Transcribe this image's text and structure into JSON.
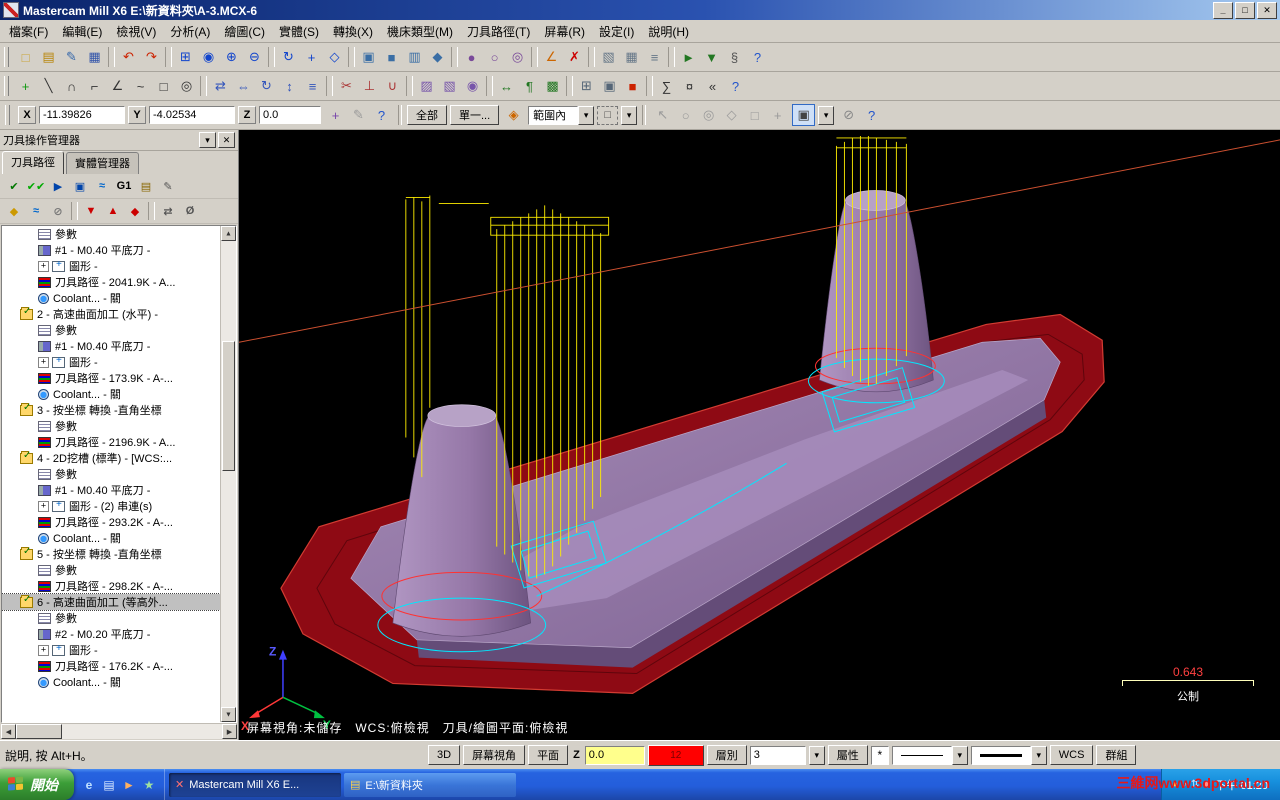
{
  "colors": {
    "toolpath_yellow": "#ffee00",
    "contour_cyan": "#00e8ff",
    "boundary_red": "#ff3232",
    "stock_red": "#8e0a14",
    "part_purple": "#967aa9",
    "viewport_bg": "#000000",
    "taskbar_blue": "#245edb",
    "title_blue": "#0a246a"
  },
  "window": {
    "title": "Mastercam Mill X6  E:\\新資料夾\\A-3.MCX-6",
    "controls": [
      {
        "name": "minimize-button",
        "glyph": "_"
      },
      {
        "name": "maximize-button",
        "glyph": "□"
      },
      {
        "name": "close-button",
        "glyph": "✕"
      }
    ]
  },
  "menu": {
    "items": [
      "檔案(F)",
      "編輯(E)",
      "檢視(V)",
      "分析(A)",
      "繪圖(C)",
      "實體(S)",
      "轉換(X)",
      "機床類型(M)",
      "刀具路徑(T)",
      "屏幕(R)",
      "設定(I)",
      "說明(H)"
    ]
  },
  "toolbar1": {
    "items": [
      {
        "name": "new-file-icon",
        "glyph": "□",
        "color": "#caa53a"
      },
      {
        "name": "open-file-icon",
        "glyph": "▤",
        "color": "#b8860b"
      },
      {
        "name": "edit-icon",
        "glyph": "✎",
        "color": "#3366aa"
      },
      {
        "name": "save-icon",
        "glyph": "▦",
        "color": "#3355aa"
      },
      {
        "name": "separator",
        "cls": "sep"
      },
      {
        "name": "undo-icon",
        "glyph": "↶",
        "color": "#cc2200"
      },
      {
        "name": "redo-icon",
        "glyph": "↷",
        "color": "#cc2200"
      },
      {
        "name": "separator",
        "cls": "sep"
      },
      {
        "name": "zoom-window-icon",
        "glyph": "⊞",
        "color": "#1144cc"
      },
      {
        "name": "zoom-target-icon",
        "glyph": "◉",
        "color": "#1144cc"
      },
      {
        "name": "zoom-in-icon",
        "glyph": "⊕",
        "color": "#1144cc"
      },
      {
        "name": "zoom-out-icon",
        "glyph": "⊖",
        "color": "#1144cc"
      },
      {
        "name": "separator",
        "cls": "sep"
      },
      {
        "name": "dynamic-rotate-icon",
        "glyph": "↻",
        "color": "#1144cc"
      },
      {
        "name": "pan-icon",
        "glyph": "+",
        "color": "#1144cc"
      },
      {
        "name": "fit-screen-icon",
        "glyph": "◇",
        "color": "#1144cc"
      },
      {
        "name": "separator",
        "cls": "sep"
      },
      {
        "name": "gview-top-icon",
        "glyph": "▣",
        "color": "#3a6ea5"
      },
      {
        "name": "gview-front-icon",
        "glyph": "■",
        "color": "#3a6ea5"
      },
      {
        "name": "gview-side-icon",
        "glyph": "▥",
        "color": "#3a6ea5"
      },
      {
        "name": "gview-iso-icon",
        "glyph": "◆",
        "color": "#3a6ea5"
      },
      {
        "name": "separator",
        "cls": "sep"
      },
      {
        "name": "shading-icon",
        "glyph": "●",
        "color": "#7a4a9a"
      },
      {
        "name": "wireframe-icon",
        "glyph": "○",
        "color": "#7a4a9a"
      },
      {
        "name": "translucency-icon",
        "glyph": "◎",
        "color": "#7a4a9a"
      },
      {
        "name": "separator",
        "cls": "sep"
      },
      {
        "name": "analyze-icon",
        "glyph": "∠",
        "color": "#cc6600"
      },
      {
        "name": "delete-entity-icon",
        "glyph": "✗",
        "color": "#cc0000"
      },
      {
        "name": "separator",
        "cls": "sep"
      },
      {
        "name": "planes-icon",
        "glyph": "▧",
        "color": "#667788"
      },
      {
        "name": "grid-icon",
        "glyph": "▦",
        "color": "#667788"
      },
      {
        "name": "levels-icon",
        "glyph": "≡",
        "color": "#667788"
      },
      {
        "name": "separator",
        "cls": "sep"
      },
      {
        "name": "toolpath-group-icon",
        "glyph": "►",
        "color": "#227722"
      },
      {
        "name": "machine-group-icon",
        "glyph": "▼",
        "color": "#227722"
      },
      {
        "name": "run-addin-icon",
        "glyph": "§",
        "color": "#555555"
      },
      {
        "name": "help-icon",
        "glyph": "?",
        "color": "#2255cc"
      }
    ]
  },
  "toolbar2": {
    "items": [
      {
        "name": "create-point-icon",
        "glyph": "+",
        "color": "#119911"
      },
      {
        "name": "create-line-icon",
        "glyph": "╲",
        "color": "#333333"
      },
      {
        "name": "create-arc-icon",
        "glyph": "∩",
        "color": "#333333"
      },
      {
        "name": "create-fillet-icon",
        "glyph": "⌐",
        "color": "#333333"
      },
      {
        "name": "create-chamfer-icon",
        "glyph": "∠",
        "color": "#333333"
      },
      {
        "name": "create-spline-icon",
        "glyph": "~",
        "color": "#333333"
      },
      {
        "name": "create-rect-icon",
        "glyph": "□",
        "color": "#333333"
      },
      {
        "name": "create-ellipse-icon",
        "glyph": "◎",
        "color": "#333333"
      },
      {
        "name": "separator",
        "cls": "sep"
      },
      {
        "name": "xform-translate-icon",
        "glyph": "⇄",
        "color": "#3355bb"
      },
      {
        "name": "xform-mirror-icon",
        "glyph": "⇔",
        "color": "#3355bb"
      },
      {
        "name": "xform-rotate-icon",
        "glyph": "↻",
        "color": "#3355bb"
      },
      {
        "name": "xform-scale-icon",
        "glyph": "↕",
        "color": "#3355bb"
      },
      {
        "name": "xform-offset-icon",
        "glyph": "≡",
        "color": "#3355bb"
      },
      {
        "name": "separator",
        "cls": "sep"
      },
      {
        "name": "trim-icon",
        "glyph": "✂",
        "color": "#aa3333"
      },
      {
        "name": "break-icon",
        "glyph": "⊥",
        "color": "#aa3333"
      },
      {
        "name": "join-icon",
        "glyph": "∪",
        "color": "#aa3333"
      },
      {
        "name": "separator",
        "cls": "sep"
      },
      {
        "name": "surface-create-icon",
        "glyph": "▨",
        "color": "#7755aa"
      },
      {
        "name": "solid-extrude-icon",
        "glyph": "▧",
        "color": "#7755aa"
      },
      {
        "name": "solid-revolve-icon",
        "glyph": "◉",
        "color": "#7755aa"
      },
      {
        "name": "separator",
        "cls": "sep"
      },
      {
        "name": "dimension-icon",
        "glyph": "↔",
        "color": "#227722"
      },
      {
        "name": "note-icon",
        "glyph": "¶",
        "color": "#227722"
      },
      {
        "name": "hatch-icon",
        "glyph": "▩",
        "color": "#227722"
      },
      {
        "name": "separator",
        "cls": "sep"
      },
      {
        "name": "layer-manager-icon",
        "glyph": "⊞",
        "color": "#556677"
      },
      {
        "name": "attributes-icon",
        "glyph": "▣",
        "color": "#556677"
      },
      {
        "name": "color-swatch-icon",
        "glyph": "■",
        "color": "#cc2200"
      },
      {
        "name": "separator",
        "cls": "sep"
      },
      {
        "name": "calculator-icon",
        "glyph": "∑",
        "color": "#333333"
      },
      {
        "name": "configuration-icon",
        "glyph": "¤",
        "color": "#333333"
      },
      {
        "name": "mru-icon",
        "glyph": "«",
        "color": "#333333"
      },
      {
        "name": "help-2-icon",
        "glyph": "?",
        "color": "#2255cc"
      }
    ]
  },
  "ribbon": {
    "x_label": "X",
    "x_value": "-11.39826",
    "y_label": "Y",
    "y_value": "-4.02534",
    "z_label": "Z",
    "z_value": "0.0",
    "icons_a": [
      {
        "name": "autocursor-icon",
        "glyph": "+",
        "color": "#7744aa"
      },
      {
        "name": "fastpoint-icon",
        "glyph": "✎",
        "color": "#999999"
      },
      {
        "name": "cursor-help-icon",
        "glyph": "?",
        "color": "#2255cc"
      }
    ],
    "all_label": "全部",
    "single_label": "單一...",
    "icons_mid": [
      {
        "name": "selection-mask-icon",
        "glyph": "◈",
        "color": "#cc6600"
      }
    ],
    "range_value": "範圍內",
    "inshape_glyph": "□",
    "icons_b": [
      {
        "name": "select-arrow-icon",
        "glyph": "↖",
        "color": "#9a9a9a"
      },
      {
        "name": "select-circle-icon",
        "glyph": "○",
        "color": "#9a9a9a"
      },
      {
        "name": "select-double-circle-icon",
        "glyph": "◎",
        "color": "#9a9a9a"
      },
      {
        "name": "select-diamond-icon",
        "glyph": "◇",
        "color": "#9a9a9a"
      },
      {
        "name": "select-box-icon",
        "glyph": "□",
        "color": "#9a9a9a"
      },
      {
        "name": "select-plus-icon",
        "glyph": "+",
        "color": "#9a9a9a"
      }
    ],
    "window_select_glyph": "▣",
    "icons_c": [
      {
        "name": "unselect-all-icon",
        "glyph": "⊘",
        "color": "#888888"
      },
      {
        "name": "selection-help-icon",
        "glyph": "?",
        "color": "#2255cc"
      }
    ]
  },
  "panel": {
    "title": "刀具操作管理器",
    "header_buttons": [
      {
        "name": "panel-menu-button",
        "glyph": "▾"
      },
      {
        "name": "panel-close-button",
        "glyph": "✕"
      }
    ],
    "tabs": [
      {
        "label": "刀具路徑",
        "cls": "active"
      },
      {
        "label": "實體管理器",
        "cls": ""
      }
    ],
    "toolbar1": [
      {
        "name": "select-all-operations-icon",
        "glyph": "✔",
        "color": "#007700"
      },
      {
        "name": "regen-all-operations-icon",
        "glyph": "✔✔",
        "color": "#00aa00"
      },
      {
        "name": "backplot-icon",
        "glyph": "▶",
        "color": "#0044aa"
      },
      {
        "name": "verify-icon",
        "glyph": "▣",
        "color": "#0044aa"
      },
      {
        "name": "simulate-icon",
        "glyph": "≈",
        "color": "#0066cc"
      },
      {
        "name": "post-icon",
        "glyph": "G1",
        "color": "#000000"
      },
      {
        "name": "feed-optimize-icon",
        "glyph": "▤",
        "color": "#886600"
      },
      {
        "name": "edit-operations-icon",
        "glyph": "✎",
        "color": "#555555"
      }
    ],
    "toolbar2": [
      {
        "name": "lock-icon",
        "glyph": "◆",
        "color": "#cc9900"
      },
      {
        "name": "toggle-toolpath-display-icon",
        "glyph": "≈",
        "color": "#0066cc"
      },
      {
        "name": "toggle-gouge-icon",
        "glyph": "⊘",
        "color": "#777777"
      },
      {
        "name": "separator",
        "cls": "sep"
      },
      {
        "name": "insert-indicator-down-icon",
        "glyph": "▼",
        "color": "#cc0000"
      },
      {
        "name": "insert-indicator-up-icon",
        "glyph": "▲",
        "color": "#cc0000"
      },
      {
        "name": "insert-arrow-icon",
        "glyph": "◆",
        "color": "#cc0000"
      },
      {
        "name": "separator",
        "cls": "sep"
      },
      {
        "name": "swap-display-icon",
        "glyph": "⇄",
        "color": "#555555"
      },
      {
        "name": "single-display-icon",
        "glyph": "Ø",
        "color": "#555555"
      }
    ],
    "tree": [
      {
        "label": "參數",
        "pad": "36px",
        "iconcls": "ic-params",
        "cls": ""
      },
      {
        "label": "#1 - M0.40 平底刀 -",
        "pad": "36px",
        "iconcls": "ic-tool",
        "cls": ""
      },
      {
        "label": "圖形 -",
        "pad": "36px",
        "iconcls": "ic-geom",
        "cls": "hasplus"
      },
      {
        "label": "刀具路徑 - 2041.9K - A...",
        "pad": "36px",
        "iconcls": "ic-path",
        "cls": ""
      },
      {
        "label": "Coolant... - 關",
        "pad": "36px",
        "iconcls": "ic-coolant",
        "cls": ""
      },
      {
        "label": "2 - 高速曲面加工 (水平) -",
        "pad": "18px",
        "iconcls": "ic-folder",
        "cls": ""
      },
      {
        "label": "參數",
        "pad": "36px",
        "iconcls": "ic-params",
        "cls": ""
      },
      {
        "label": "#1 - M0.40 平底刀 -",
        "pad": "36px",
        "iconcls": "ic-tool",
        "cls": ""
      },
      {
        "label": "圖形 -",
        "pad": "36px",
        "iconcls": "ic-geom",
        "cls": "hasplus"
      },
      {
        "label": "刀具路徑 - 173.9K - A-...",
        "pad": "36px",
        "iconcls": "ic-path",
        "cls": ""
      },
      {
        "label": "Coolant... - 關",
        "pad": "36px",
        "iconcls": "ic-coolant",
        "cls": ""
      },
      {
        "label": "3 - 按坐標 轉換 -直角坐標",
        "pad": "18px",
        "iconcls": "ic-folder",
        "cls": ""
      },
      {
        "label": "參數",
        "pad": "36px",
        "iconcls": "ic-params",
        "cls": ""
      },
      {
        "label": "刀具路徑 - 2196.9K - A...",
        "pad": "36px",
        "iconcls": "ic-path",
        "cls": ""
      },
      {
        "label": "4 - 2D挖槽 (標準) - [WCS:...",
        "pad": "18px",
        "iconcls": "ic-folder",
        "cls": ""
      },
      {
        "label": "參數",
        "pad": "36px",
        "iconcls": "ic-params",
        "cls": ""
      },
      {
        "label": "#1 - M0.40 平底刀 -",
        "pad": "36px",
        "iconcls": "ic-tool",
        "cls": ""
      },
      {
        "label": "圖形 - (2) 串連(s)",
        "pad": "36px",
        "iconcls": "ic-geom",
        "cls": "hasplus"
      },
      {
        "label": "刀具路徑 - 293.2K - A-...",
        "pad": "36px",
        "iconcls": "ic-path",
        "cls": ""
      },
      {
        "label": "Coolant... - 關",
        "pad": "36px",
        "iconcls": "ic-coolant",
        "cls": ""
      },
      {
        "label": "5 - 按坐標 轉換 -直角坐標",
        "pad": "18px",
        "iconcls": "ic-folder",
        "cls": ""
      },
      {
        "label": "參數",
        "pad": "36px",
        "iconcls": "ic-params",
        "cls": ""
      },
      {
        "label": "刀具路徑 - 298.2K - A-...",
        "pad": "36px",
        "iconcls": "ic-path",
        "cls": ""
      },
      {
        "label": "6 - 高速曲面加工 (等高外...",
        "pad": "18px",
        "iconcls": "ic-folder",
        "cls": "sel"
      },
      {
        "label": "參數",
        "pad": "36px",
        "iconcls": "ic-params",
        "cls": ""
      },
      {
        "label": "#2 - M0.20 平底刀 -",
        "pad": "36px",
        "iconcls": "ic-tool",
        "cls": ""
      },
      {
        "label": "圖形 -",
        "pad": "36px",
        "iconcls": "ic-geom",
        "cls": "hasplus"
      },
      {
        "label": "刀具路徑 - 176.2K - A-...",
        "pad": "36px",
        "iconcls": "ic-path",
        "cls": ""
      },
      {
        "label": "Coolant... - 關",
        "pad": "36px",
        "iconcls": "ic-coolant",
        "cls": ""
      }
    ]
  },
  "viewport": {
    "status_line": "屏幕視角:未儲存　WCS:俯檢視　刀具/繪圖平面:俯檢視",
    "scale_value": "0.643",
    "units": "公制",
    "axis_x": "X",
    "axis_y": "Y",
    "axis_z": "Z"
  },
  "statusbar": {
    "help_text": "說明, 按 Alt+H。",
    "btn_3d": "3D",
    "btn_gview": "屏幕視角",
    "btn_planes": "平面",
    "z_label": "Z",
    "z_value": "0.0",
    "color_value": "12",
    "level_label": "層別",
    "level_value": "3",
    "attr_label": "屬性",
    "star": "*",
    "wcs_label": "WCS",
    "groups_label": "群組"
  },
  "taskbar": {
    "start_label": "開始",
    "quick_launch": [
      {
        "name": "ie-icon",
        "glyph": "e",
        "color": "#bfe0ff"
      },
      {
        "name": "show-desktop-icon",
        "glyph": "▤",
        "color": "#d8e8ff"
      },
      {
        "name": "media-player-icon",
        "glyph": "►",
        "color": "#ffb060"
      },
      {
        "name": "messenger-icon",
        "glyph": "★",
        "color": "#9fe09f"
      }
    ],
    "tasks": [
      {
        "label": "Mastercam Mill X6  E...",
        "cls": "active",
        "ico_glyph": "✕",
        "ico_color": "#ff7070"
      },
      {
        "label": "E:\\新資料夾",
        "cls": "",
        "ico_glyph": "▤",
        "ico_color": "#ffd24a"
      }
    ],
    "tray_icons": [
      {
        "name": "update-tray-icon",
        "glyph": "●",
        "color": "#ffd24a"
      },
      {
        "name": "volume-tray-icon",
        "glyph": "♪",
        "color": "#ffffff"
      },
      {
        "name": "network-tray-icon",
        "glyph": "⇅",
        "color": "#cfe4ff"
      },
      {
        "name": "antivirus-tray-icon",
        "glyph": "■",
        "color": "#ff8f8f"
      }
    ],
    "time": "下午 01:20",
    "watermark": "三維网www.3dportal.cn"
  }
}
